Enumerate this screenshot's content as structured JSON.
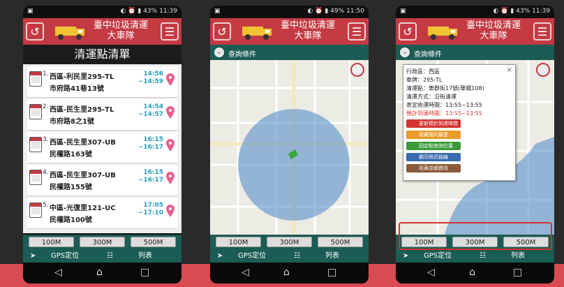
{
  "app": {
    "title_line1": "臺中垃圾清運",
    "title_line2": "大車隊",
    "back_icon": "back-arrow-icon",
    "menu_icon": "menu-icon"
  },
  "phones": [
    {
      "status_time": "11:39",
      "status_battery": "43%"
    },
    {
      "status_time": "11:50",
      "status_battery": "49%"
    },
    {
      "status_time": "11:39",
      "status_battery": "43%"
    }
  ],
  "list": {
    "title": "清運點清單",
    "items": [
      {
        "num": "1.",
        "name": "西區-利民里295-TL",
        "addr": "市府路41巷13號",
        "time": "14:56\n~14:59"
      },
      {
        "num": "2.",
        "name": "西區-民生里295-TL",
        "addr": "市府路8之1號",
        "time": "14:54\n~14:57"
      },
      {
        "num": "3.",
        "name": "西區-民生里307-UB",
        "addr": "民權路163號",
        "time": "16:15\n~16:17"
      },
      {
        "num": "4.",
        "name": "西區-民生里307-UB",
        "addr": "民權路155號",
        "time": "16:15\n~16:17"
      },
      {
        "num": "5.",
        "name": "中區-光復里121-UC",
        "addr": "民權路100號",
        "time": "17:05\n~17:10"
      }
    ]
  },
  "distance": {
    "d1": "100M",
    "d2": "300M",
    "d3": "500M"
  },
  "tabs": {
    "gps": "GPS定位",
    "list": "列表"
  },
  "query": {
    "label": "查詢條件"
  },
  "popup": {
    "district": "行政區：西區",
    "plate": "車牌：295-TL",
    "spot": "清運點：樂群街17號(華楊108)",
    "method": "清運方式：沿街清運",
    "scheduled": "表定收運時間：13:55~13:55",
    "estimated": "預計到達時間：13:55~13:55",
    "btn1": "更新預計到達時間",
    "btn2": "收藏我的最愛",
    "btn3": "回定點查詢位置",
    "btn4": "顯示附近路線",
    "btn5": "班表詳細資訊",
    "close": "×"
  },
  "colors": {
    "brand_red": "#c43a43",
    "teal": "#1b5c54",
    "pin": "#d93a3a",
    "circle": "#4a86c8",
    "bottom_strip": "#d94a52"
  }
}
